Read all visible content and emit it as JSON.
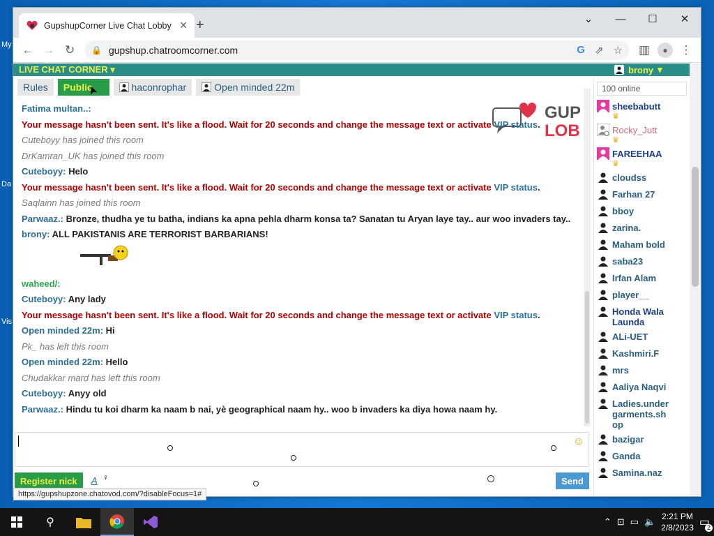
{
  "browser": {
    "tab_title": "GupshupCorner Live Chat Lobby",
    "url": "gupshup.chatroomcorner.com",
    "status_url": "https://gupshupzone.chatovod.com/?disableFocus=1#"
  },
  "chat": {
    "brand": "LIVE CHAT CORNER",
    "current_user": "brony",
    "tabs": [
      {
        "label": "Rules",
        "active": false,
        "person": false
      },
      {
        "label": "Public",
        "active": true,
        "person": false
      },
      {
        "label": "haconrophar",
        "active": false,
        "person": true
      },
      {
        "label": "Open minded 22m",
        "active": false,
        "person": true
      }
    ],
    "messages": [
      {
        "type": "chat",
        "nick": "Fatima multan..",
        "text": ""
      },
      {
        "type": "flood",
        "text": "Your message hasn't been sent. It's like a flood. Wait for 20 seconds and change the message text or activate ",
        "link": "VIP status",
        "end": "."
      },
      {
        "type": "sys",
        "text": "Cuteboyy has joined this room"
      },
      {
        "type": "sys",
        "text": "DrKamran_UK has joined this room"
      },
      {
        "type": "chat",
        "nick": "Cuteboyy",
        "text": "Helo"
      },
      {
        "type": "flood",
        "text": "Your message hasn't been sent. It's like a flood. Wait for 20 seconds and change the message text or activate ",
        "link": "VIP status",
        "end": "."
      },
      {
        "type": "sys",
        "text": "Saqlainn has joined this room"
      },
      {
        "type": "chat",
        "nick": "Parwaaz.",
        "text": "Bronze, thudha ye tu batha, indians ka apna pehla dharm konsa ta? Sanatan tu Aryan laye tay.. aur woo invaders tay.."
      },
      {
        "type": "chat",
        "nick": "brony",
        "text": "ALL PAKISTANIS ARE TERRORIST BARBARIANS!"
      },
      {
        "type": "gun"
      },
      {
        "type": "chat-green",
        "nick": "waheed/",
        "text": ""
      },
      {
        "type": "chat",
        "nick": "Cuteboyy",
        "text": "Any lady"
      },
      {
        "type": "flood",
        "text": "Your message hasn't been sent. It's like a flood. Wait for 20 seconds and change the message text or activate ",
        "link": "VIP status",
        "end": "."
      },
      {
        "type": "chat",
        "nick": "Open minded 22m",
        "text": "Hi"
      },
      {
        "type": "sys",
        "text": "Pk_ has left this room"
      },
      {
        "type": "chat",
        "nick": "Open minded 22m",
        "text": "Hello"
      },
      {
        "type": "sys",
        "text": "Chudakkar mard has left this room"
      },
      {
        "type": "chat",
        "nick": "Cuteboyy",
        "text": "Anyy old"
      },
      {
        "type": "chat",
        "nick": "Parwaaz.",
        "text": "Hindu tu koi dharm ka naam b nai, yè geographical naam hy.. woo b invaders ka diya howa naam hy."
      }
    ],
    "register_label": "Register nick",
    "font_label": "A",
    "send_label": "Send",
    "logo_text": "GUP",
    "logo_text2": "LOB"
  },
  "sidebar": {
    "online_count": "100 online",
    "users": [
      {
        "name": "sheebabutt",
        "style": "pink",
        "crown": true,
        "icon": "female"
      },
      {
        "name": "Rocky_Jutt",
        "style": "faded",
        "crown": true,
        "icon": "male-away"
      },
      {
        "name": "FAREEHAA",
        "style": "pink",
        "crown": true,
        "icon": "female"
      },
      {
        "name": "cloudss",
        "style": "",
        "crown": false,
        "icon": "male"
      },
      {
        "name": "Farhan 27",
        "style": "",
        "crown": false,
        "icon": "male"
      },
      {
        "name": "bboy",
        "style": "",
        "crown": false,
        "icon": "male"
      },
      {
        "name": "zarina.",
        "style": "",
        "crown": false,
        "icon": "male"
      },
      {
        "name": "Maham bold",
        "style": "",
        "crown": false,
        "icon": "male"
      },
      {
        "name": "saba23",
        "style": "",
        "crown": false,
        "icon": "male"
      },
      {
        "name": "Irfan Alam",
        "style": "",
        "crown": false,
        "icon": "male"
      },
      {
        "name": "player__",
        "style": "",
        "crown": false,
        "icon": "male"
      },
      {
        "name": "Honda Wala Launda",
        "style": "dark",
        "crown": false,
        "icon": "male"
      },
      {
        "name": "ALi-UET",
        "style": "",
        "crown": false,
        "icon": "male"
      },
      {
        "name": "Kashmiri.F",
        "style": "",
        "crown": false,
        "icon": "male"
      },
      {
        "name": "mrs",
        "style": "",
        "crown": false,
        "icon": "male"
      },
      {
        "name": "Aaliya Naqvi",
        "style": "",
        "crown": false,
        "icon": "male"
      },
      {
        "name": "Ladies.undergarments.shop",
        "style": "",
        "crown": false,
        "icon": "male"
      },
      {
        "name": "bazigar",
        "style": "",
        "crown": false,
        "icon": "male"
      },
      {
        "name": "Ganda",
        "style": "",
        "crown": false,
        "icon": "male"
      },
      {
        "name": "Samina.naz",
        "style": "",
        "crown": false,
        "icon": "male"
      }
    ]
  },
  "desktop": {
    "labels": [
      "My",
      "Da",
      "Vis"
    ]
  },
  "taskbar": {
    "time": "2:21 PM",
    "date": "2/8/2023",
    "notifications": "2"
  }
}
